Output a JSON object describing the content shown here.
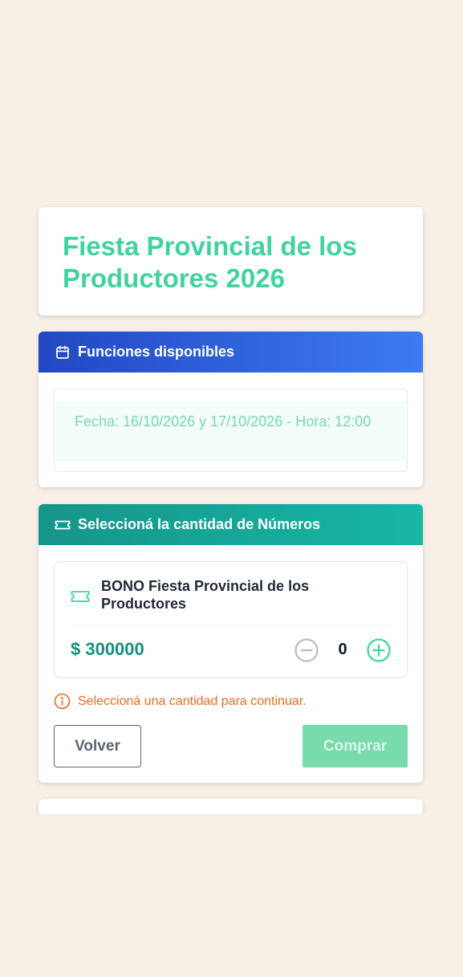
{
  "event": {
    "title": "Fiesta Provincial de los Productores 2026"
  },
  "funciones": {
    "header": "Funciones disponibles",
    "header_icon": "calendar-icon",
    "items": [
      {
        "label": "Fecha: 16/10/2026 y 17/10/2026 - Hora: 12:00"
      }
    ]
  },
  "numeros": {
    "header": "Seleccioná la cantidad de Números",
    "header_icon": "ticket-icon",
    "ticket": {
      "name": "BONO Fiesta Provincial de los Productores",
      "icon": "ticket-icon",
      "price": "$ 300000",
      "quantity": "0"
    },
    "warning": "Seleccioná una cantidad para continuar.",
    "back_label": "Volver",
    "buy_label": "Comprar"
  },
  "colors": {
    "background": "#f8efe6",
    "title_green": "#3fd3a1",
    "header_blue_start": "#2347c3",
    "header_blue_end": "#3b7cf0",
    "header_teal_start": "#16958a",
    "header_teal_end": "#17b7a4",
    "price_teal": "#168f80",
    "warning_orange": "#ea6b1e",
    "buy_disabled": "#79dbab"
  }
}
